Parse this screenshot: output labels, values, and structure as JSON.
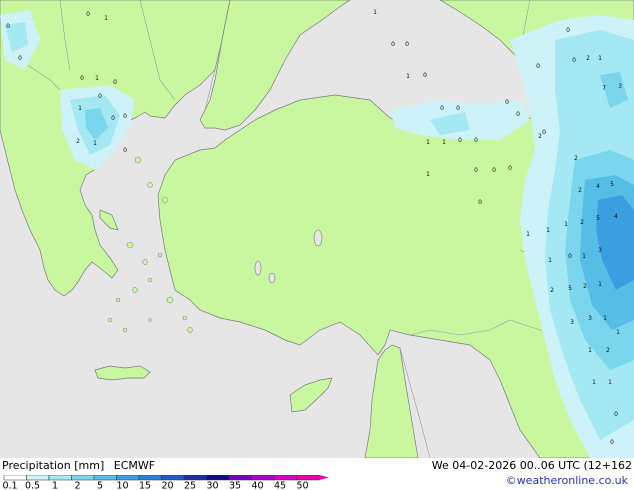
{
  "map": {
    "colors": {
      "sea": "#e6e6e6",
      "land": "#c8f7a0",
      "coast": "#7a7a7a",
      "border": "#9a9a9a",
      "precip_levels": [
        "#cdf2f7",
        "#a4e8f3",
        "#7ad6ec",
        "#56bde6",
        "#3a9fe0",
        "#2a7fd6"
      ]
    },
    "labels": [
      "0",
      "1",
      "0",
      "0",
      "0",
      "1",
      "0",
      "0",
      "0",
      "1",
      "0",
      "2",
      "1",
      "0",
      "1",
      "7",
      "3",
      "0",
      "0",
      "0",
      "1",
      "0",
      "0",
      "0",
      "0",
      "0",
      "0",
      "2",
      "1",
      "0",
      "2",
      "4",
      "2",
      "5",
      "4",
      "2",
      "5",
      "1",
      "1",
      "0",
      "1",
      "3",
      "2",
      "5",
      "1",
      "2",
      "3",
      "1",
      "3",
      "1",
      "1",
      "2",
      "1",
      "1",
      "0",
      "1",
      "0",
      "1",
      "0",
      "2",
      "0",
      "0",
      "1",
      "0",
      "0",
      "0",
      "0",
      "1",
      "1"
    ]
  },
  "legend": {
    "title": "Precipitation [mm]",
    "model": "ECMWF",
    "ticks": [
      "0.1",
      "0.5",
      "1",
      "2",
      "5",
      "10",
      "15",
      "20",
      "25",
      "30",
      "35",
      "40",
      "45",
      "50"
    ],
    "colors": [
      "#ffffff",
      "#cdf2f7",
      "#a4e8f3",
      "#7ad6ec",
      "#56bde6",
      "#3a9fe0",
      "#2a7fd6",
      "#2259c4",
      "#1b2fa8",
      "#120a84",
      "#7a00c8",
      "#b000d8",
      "#d800c8",
      "#e800a8"
    ]
  },
  "footer": {
    "valid": "We 04-02-2026 00..06 UTC (12+162",
    "credit": "©weatheronline.co.uk"
  }
}
